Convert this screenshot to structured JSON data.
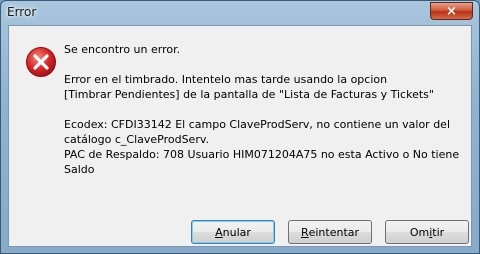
{
  "window": {
    "title": "Error",
    "close_symbol": "×"
  },
  "icon": "error-icon",
  "message": {
    "line1": "Se encontro un error.",
    "line2": "Error en el timbrado. Intentelo mas tarde usando la opcion\n[Timbrar Pendientes] de la pantalla de \"Lista de Facturas y Tickets\"",
    "line3": "Ecodex: CFDI33142 El campo ClaveProdServ, no contiene un valor del\ncatálogo c_ClaveProdServ.\nPAC de Respaldo: 708  Usuario HIM071204A75 no esta Activo o No tiene\nSaldo"
  },
  "buttons": {
    "anular": {
      "mnemonic": "A",
      "rest": "nular"
    },
    "reintentar": {
      "mnemonic": "R",
      "rest": "eintentar"
    },
    "omitir": {
      "pre": "Om",
      "mnemonic": "i",
      "rest": "tir"
    }
  },
  "colors": {
    "error_red": "#d8262b",
    "close_red": "#c7452a"
  }
}
